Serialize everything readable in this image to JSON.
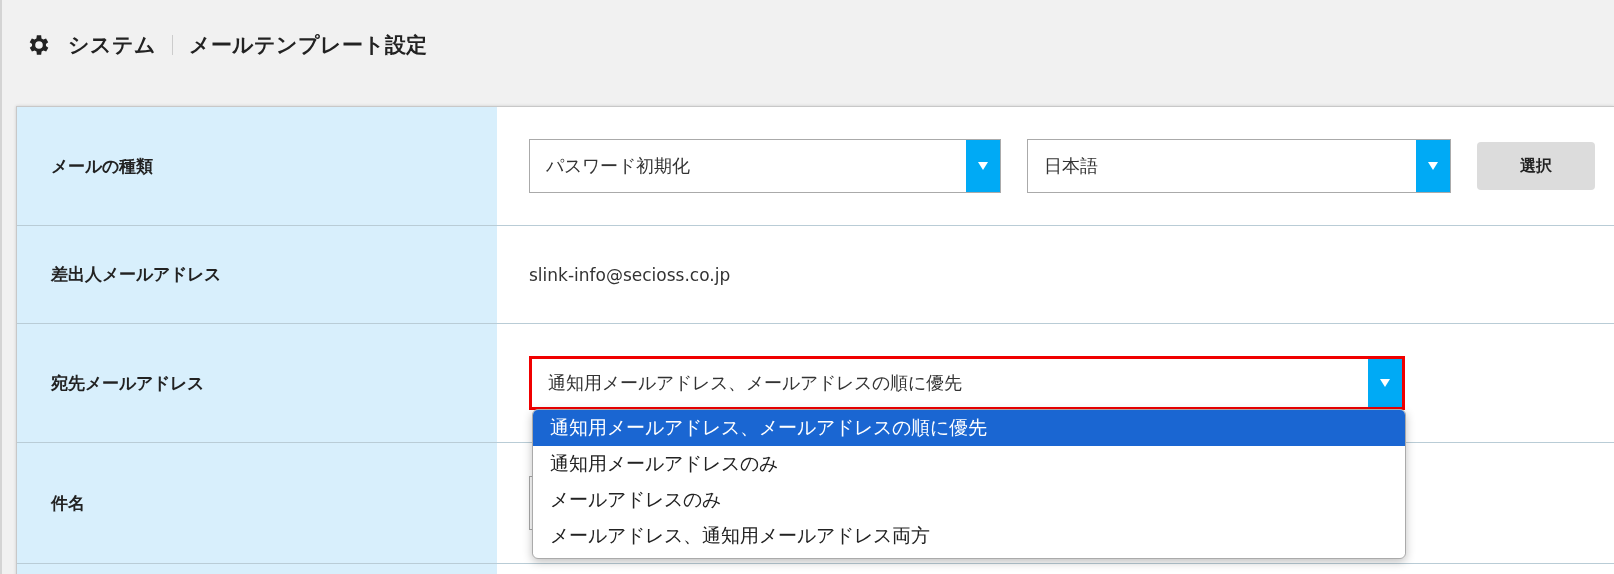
{
  "header": {
    "breadcrumb": [
      "システム",
      "メールテンプレート設定"
    ]
  },
  "rows": [
    {
      "label": "メールの種類",
      "kind": "selects",
      "selects": [
        {
          "value": "パスワード初期化"
        },
        {
          "value": "日本語"
        }
      ],
      "button": "選択"
    },
    {
      "label": "差出人メールアドレス",
      "kind": "text",
      "value": "slink-info@secioss.co.jp"
    },
    {
      "label": "宛先メールアドレス",
      "kind": "dropdown",
      "value": "通知用メールアドレス、メールアドレスの順に優先",
      "highlighted": true,
      "expanded": true,
      "options": [
        {
          "label": "通知用メールアドレス、メールアドレスの順に優先",
          "selected": true
        },
        {
          "label": "通知用メールアドレスのみ",
          "selected": false
        },
        {
          "label": "メールアドレスのみ",
          "selected": false
        },
        {
          "label": "メールアドレス、通知用メールアドレス両方",
          "selected": false
        }
      ]
    },
    {
      "label": "件名",
      "kind": "input"
    },
    {
      "kind": "empty"
    }
  ]
}
